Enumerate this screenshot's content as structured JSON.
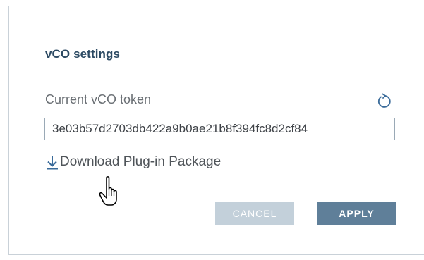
{
  "dialog": {
    "title": "vCO settings",
    "token_label": "Current vCO token",
    "token_value": "3e03b57d2703db422a9b0ae21b8f394fc8d2cf84",
    "refresh_icon": "refresh-icon",
    "download_icon": "download-arrow-icon",
    "download_link_label": "Download Plug-in Package",
    "cursor_icon": "hand-pointer-icon",
    "cancel_label": "CANCEL",
    "apply_label": "APPLY"
  },
  "colors": {
    "title": "#2c4a63",
    "accent": "#3a6b9a",
    "apply_bg": "#5f7f99",
    "cancel_bg": "#c3d0da",
    "input_border": "#9aa9b6"
  }
}
